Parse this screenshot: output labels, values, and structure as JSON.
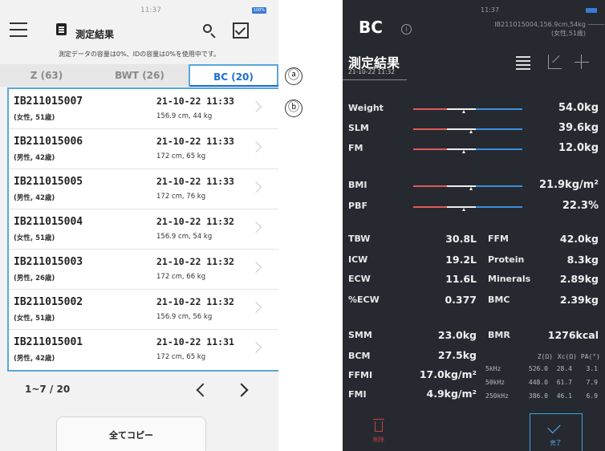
{
  "left": {
    "status_time": "11:37",
    "battery": "100%",
    "title": "測定結果",
    "usage_note": "測定データの容量は0%、IDの容量は0%を使用中です。",
    "tabs": [
      {
        "label": "Z (63)",
        "active": false
      },
      {
        "label": "BWT (26)",
        "active": false
      },
      {
        "label": "BC (20)",
        "active": true
      }
    ],
    "rows": [
      {
        "id": "IB211015007",
        "info": "(女性, 51歳)",
        "date": "21-10-22 11:33",
        "body": "156.9 cm, 44 kg"
      },
      {
        "id": "IB211015006",
        "info": "(男性, 42歳)",
        "date": "21-10-22 11:33",
        "body": "172 cm, 65 kg"
      },
      {
        "id": "IB211015005",
        "info": "(男性, 42歳)",
        "date": "21-10-22 11:33",
        "body": "172 cm, 76 kg"
      },
      {
        "id": "IB211015004",
        "info": "(女性, 51歳)",
        "date": "21-10-22 11:32",
        "body": "156.9 cm, 54 kg"
      },
      {
        "id": "IB211015003",
        "info": "(男性, 26歳)",
        "date": "21-10-22 11:32",
        "body": "172 cm, 66 kg"
      },
      {
        "id": "IB211015002",
        "info": "(女性, 51歳)",
        "date": "21-10-22 11:32",
        "body": "156.9 cm, 56 kg"
      },
      {
        "id": "IB211015001",
        "info": "(男性, 42歳)",
        "date": "21-10-22 11:31",
        "body": "172 cm, 65 kg"
      }
    ],
    "pager": "1~7 / 20",
    "copy_all": "全てコピー",
    "marker_a": "ⓐ",
    "marker_b": "ⓑ"
  },
  "right": {
    "status_time": "11:37",
    "header": "BC",
    "info_icon": "ⓘ",
    "subject_line1": "IB211015004,156.9cm,54kg",
    "subject_line2": "(女性,51歳)",
    "title": "測定結果",
    "datetime": "21-10-22 11:32",
    "bars": [
      {
        "label": "Weight",
        "value": "54.0kg",
        "level": 0.47
      },
      {
        "label": "SLM",
        "value": "39.6kg",
        "level": 0.53
      },
      {
        "label": "FM",
        "value": "12.0kg",
        "level": 0.47
      },
      {
        "label": "BMI",
        "value": "21.9kg/m²",
        "level": 0.53
      },
      {
        "label": "PBF",
        "value": "22.3%",
        "level": 0.47
      }
    ],
    "grid_left": [
      {
        "label": "TBW",
        "value": "30.8L"
      },
      {
        "label": "ICW",
        "value": "19.2L"
      },
      {
        "label": "ECW",
        "value": "11.6L"
      },
      {
        "label": "%ECW",
        "value": "0.377"
      }
    ],
    "grid_right": [
      {
        "label": "FFM",
        "value": "42.0kg"
      },
      {
        "label": "Protein",
        "value": "8.3kg"
      },
      {
        "label": "Minerals",
        "value": "2.89kg"
      },
      {
        "label": "BMC",
        "value": "2.39kg"
      }
    ],
    "grid2_left": [
      {
        "label": "SMM",
        "value": "23.0kg"
      },
      {
        "label": "BCM",
        "value": "27.5kg"
      },
      {
        "label": "FFMI",
        "value": "17.0kg/m²"
      },
      {
        "label": "FMI",
        "value": "4.9kg/m²"
      }
    ],
    "bmr": {
      "label": "BMR",
      "value": "1276kcal"
    },
    "impedance": {
      "headers": [
        "Z(Ω)",
        "Xc(Ω)",
        "PA(°)"
      ],
      "rows": [
        {
          "freq": "5kHz",
          "z": "526.0",
          "xc": "28.4",
          "pa": "3.1"
        },
        {
          "freq": "50kHz",
          "z": "448.0",
          "xc": "61.7",
          "pa": "7.9"
        },
        {
          "freq": "250kHz",
          "z": "386.0",
          "xc": "46.1",
          "pa": "6.9"
        }
      ]
    },
    "delete_label": "削除",
    "done_label": "完了"
  }
}
